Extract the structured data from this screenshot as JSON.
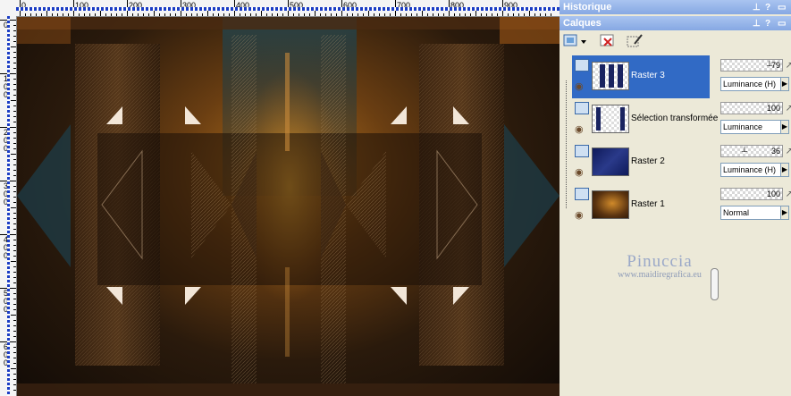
{
  "rulers": {
    "top_labels": [
      "0",
      "100",
      "200",
      "300",
      "400",
      "500",
      "600",
      "700",
      "800",
      "900"
    ],
    "left_labels": [
      "0",
      "1\n0\n0",
      "2\n0\n0",
      "3\n0\n0",
      "4\n0\n0",
      "5\n0\n0",
      "6\n0\n0"
    ]
  },
  "panels": {
    "history_title": "Historique",
    "layers_title": "Calques"
  },
  "layers": [
    {
      "name": "Raster 3",
      "opacity": "79",
      "blend": "Luminance (H)",
      "selected": true
    },
    {
      "name": "Sélection transformée",
      "opacity": "100",
      "blend": "Luminance",
      "selected": false
    },
    {
      "name": "Raster 2",
      "opacity": "36",
      "blend": "Luminance (H)",
      "selected": false
    },
    {
      "name": "Raster 1",
      "opacity": "100",
      "blend": "Normal",
      "selected": false
    }
  ],
  "watermark": {
    "title": "Pinuccia",
    "url": "www.maidiregrafica.eu"
  },
  "colors": {
    "panel_title": "#86a8e3",
    "selection": "#316ac5",
    "panel_bg": "#ece9d8"
  }
}
